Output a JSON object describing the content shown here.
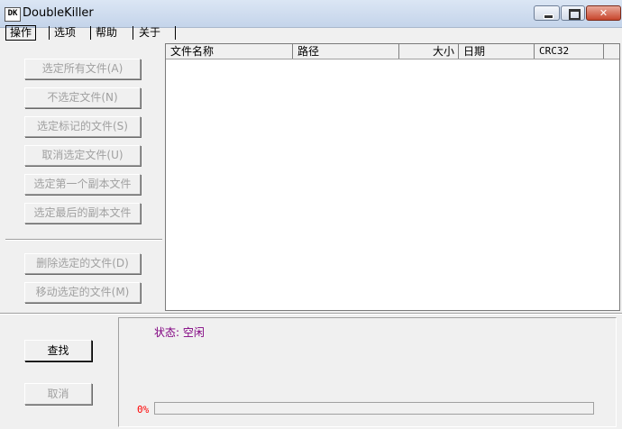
{
  "window": {
    "title": "DoubleKiller",
    "icon_text": "DK"
  },
  "menu": {
    "items": [
      {
        "label": "操作"
      },
      {
        "label": "选项"
      },
      {
        "label": "帮助"
      },
      {
        "label": "关于"
      }
    ]
  },
  "sidebar": {
    "buttons": [
      {
        "label": "选定所有文件(A)"
      },
      {
        "label": "不选定文件(N)"
      },
      {
        "label": "选定标记的文件(S)"
      },
      {
        "label": "取消选定文件(U)"
      },
      {
        "label": "选定第一个副本文件"
      },
      {
        "label": "选定最后的副本文件"
      },
      {
        "label": "删除选定的文件(D)"
      },
      {
        "label": "移动选定的文件(M)"
      }
    ]
  },
  "file_list": {
    "columns": [
      {
        "label": "文件名称"
      },
      {
        "label": "路径"
      },
      {
        "label": "大小"
      },
      {
        "label": "日期"
      },
      {
        "label": "CRC32"
      }
    ],
    "rows": []
  },
  "actions": {
    "search_label": "查找",
    "cancel_label": "取消"
  },
  "status": {
    "text": "状态: 空闲",
    "percent_label": "0%",
    "progress": 0,
    "status_color": "#800080",
    "percent_color": "#ff0000"
  }
}
